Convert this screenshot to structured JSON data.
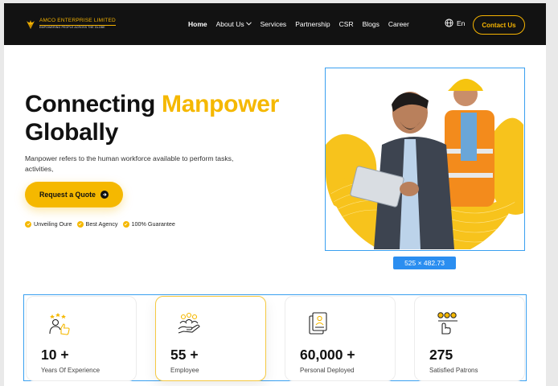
{
  "brand": {
    "name": "AMCO ENTERPRISE LIMITED",
    "tagline": "EMPOWERING PEOPLE ACROSS THE GLOBE"
  },
  "nav": {
    "items": [
      {
        "label": "Home",
        "active": true
      },
      {
        "label": "About Us",
        "dropdown": true
      },
      {
        "label": "Services"
      },
      {
        "label": "Partnership"
      },
      {
        "label": "CSR"
      },
      {
        "label": "Blogs"
      },
      {
        "label": "Career"
      }
    ],
    "language": "En",
    "contact_label": "Contact Us"
  },
  "hero": {
    "title_part1": "Connecting",
    "title_accent": "Manpower",
    "title_part2": "Globally",
    "description": "Manpower refers to the human workforce available to perform tasks, activities,",
    "cta_label": "Request a Quote",
    "badges": [
      "Unveiling Oure",
      "Best Agency",
      "100% Guarantee"
    ],
    "image_size_tag": "525 × 482.73"
  },
  "stats": [
    {
      "value": "10 +",
      "label": "Years Of Experience",
      "icon": "rating-thumbs-up-icon"
    },
    {
      "value": "55 +",
      "label": "Employee",
      "icon": "team-hand-icon"
    },
    {
      "value": "60,000 +",
      "label": "Personal Deployed",
      "icon": "resume-document-icon"
    },
    {
      "value": "275",
      "label": "Satisfied Patrons",
      "icon": "feedback-rating-icon"
    }
  ],
  "colors": {
    "accent": "#f5b800",
    "header_bg": "#121212",
    "selection_outline": "#3aa0f0"
  }
}
